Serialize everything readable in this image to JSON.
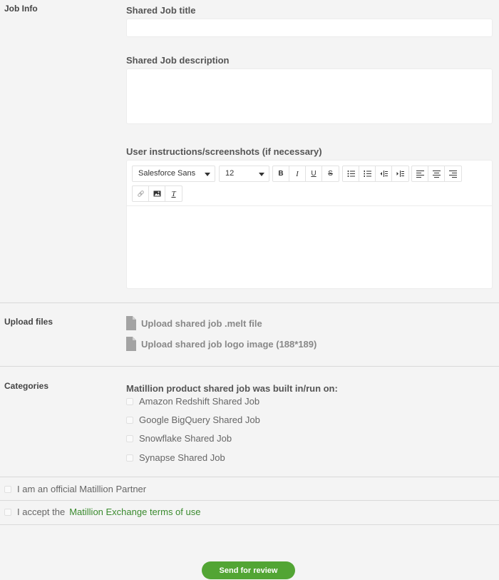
{
  "job_info": {
    "section_label": "Job Info",
    "title_label": "Shared Job title",
    "title_value": "",
    "description_label": "Shared Job description",
    "description_value": "",
    "instructions_label": "User instructions/screenshots (if necessary)",
    "editor": {
      "font_family": "Salesforce Sans",
      "font_size": "12",
      "buttons": [
        "bold",
        "italic",
        "underline",
        "strikethrough",
        "bullet-list",
        "numbered-list",
        "outdent",
        "indent",
        "align-left",
        "align-center",
        "align-right",
        "link",
        "image",
        "clear-format"
      ],
      "bold": "B",
      "italic": "I",
      "underline": "U",
      "strike": "S",
      "clear": "T"
    }
  },
  "upload": {
    "section_label": "Upload files",
    "melt_file": "Upload shared job .melt file",
    "logo_image": "Upload shared job logo image (188*189)"
  },
  "categories": {
    "section_label": "Categories",
    "heading": "Matillion product shared job was built in/run on:",
    "options": [
      {
        "label": "Amazon Redshift Shared Job",
        "checked": false
      },
      {
        "label": "Google BigQuery Shared Job",
        "checked": false
      },
      {
        "label": "Snowflake Shared Job",
        "checked": false
      },
      {
        "label": "Synapse Shared Job",
        "checked": false
      }
    ]
  },
  "partner": {
    "label": "I am an official Matillion Partner",
    "checked": false
  },
  "terms": {
    "prefix": "I accept the",
    "link": "Matillion Exchange terms of use",
    "checked": false
  },
  "submit": {
    "label": "Send for review"
  },
  "colors": {
    "accent": "#52a534",
    "link": "#3a8a2e",
    "background": "#f4f4f4"
  }
}
